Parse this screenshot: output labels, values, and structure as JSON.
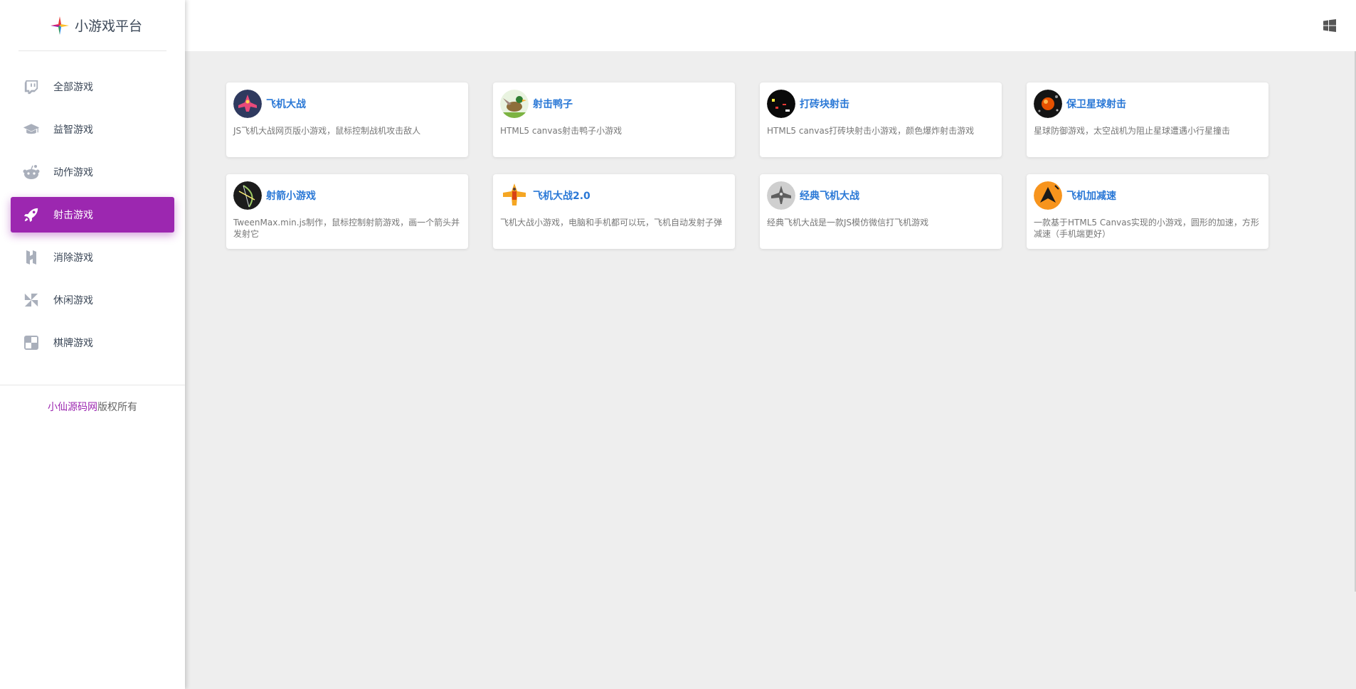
{
  "brand": {
    "title": "小游戏平台"
  },
  "sidebar": {
    "items": [
      {
        "label": "全部游戏",
        "icon": "twitch-icon"
      },
      {
        "label": "益智游戏",
        "icon": "graduation-cap-icon"
      },
      {
        "label": "动作游戏",
        "icon": "reddit-icon"
      },
      {
        "label": "射击游戏",
        "icon": "rocket-icon",
        "active": true
      },
      {
        "label": "消除游戏",
        "icon": "hacker-news-icon"
      },
      {
        "label": "休闲游戏",
        "icon": "pinwheel-icon"
      },
      {
        "label": "棋牌游戏",
        "icon": "chess-board-icon"
      }
    ],
    "copyright_site": "小仙源码网",
    "copyright_suffix": "版权所有"
  },
  "header": {
    "windows_icon": "windows-icon"
  },
  "games": [
    {
      "title": "飞机大战",
      "desc": "JS飞机大战网页版小游戏，鼠标控制战机攻击敌人",
      "thumb": "plane-thumb"
    },
    {
      "title": "射击鸭子",
      "desc": "HTML5 canvas射击鸭子小游戏",
      "thumb": "duck-thumb"
    },
    {
      "title": "打砖块射击",
      "desc": "HTML5 canvas打砖块射击小游戏，颜色爆炸射击游戏",
      "thumb": "brick-thumb"
    },
    {
      "title": "保卫星球射击",
      "desc": "星球防御游戏，太空战机为阻止星球遭遇小行星撞击",
      "thumb": "planet-thumb"
    },
    {
      "title": "射箭小游戏",
      "desc": "TweenMax.min.js制作，鼠标控制射箭游戏，画一个箭头并发射它",
      "thumb": "archery-thumb"
    },
    {
      "title": "飞机大战2.0",
      "desc": "飞机大战小游戏，电脑和手机都可以玩，飞机自动发射子弹",
      "thumb": "plane2-thumb"
    },
    {
      "title": "经典飞机大战",
      "desc": "经典飞机大战是一款JS模仿微信打飞机游戏",
      "thumb": "classic-plane-thumb"
    },
    {
      "title": "飞机加减速",
      "desc": "一款基于HTML5 Canvas实现的小游戏，圆形的加速，方形减速（手机端更好）",
      "thumb": "speed-thumb"
    }
  ],
  "colors": {
    "accent": "#9c27b0",
    "link": "#2a78d6",
    "background": "#eeeeee"
  }
}
